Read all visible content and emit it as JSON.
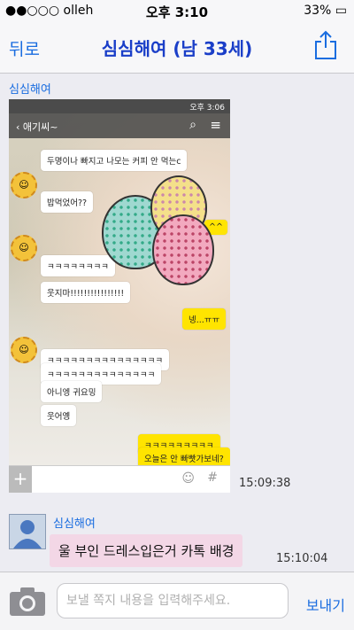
{
  "status_bar": {
    "carrier": "●●○○○ olleh",
    "time": "오후 3:10",
    "battery": "33%"
  },
  "nav": {
    "back": "뒤로",
    "title": "심심해여 (남 33세)"
  },
  "sender_label_top": "심심해여",
  "screenshot": {
    "status_time": "오후 3:06",
    "chat_name": "애기씨~",
    "messages": [
      {
        "text": "두명이나 빠지고 나모는 커피 안 먹는c",
        "mine": false
      },
      {
        "text": "밥먹었어??",
        "mine": false
      },
      {
        "text": "ㅋㅋㅋㅋㅋㅋㅋㅋ",
        "mine": false
      },
      {
        "text": "웃지마!!!!!!!!!!!!!!!!",
        "mine": false
      },
      {
        "text": "넹...ㅠㅠ",
        "mine": true
      },
      {
        "text": "ㅋㅋㅋㅋㅋㅋㅋㅋㅋㅋㅋㅋㅋㅋㅋ",
        "mine": false
      },
      {
        "text": "ㅋㅋㅋㅋㅋㅋㅋㅋㅋㅋㅋㅋㅋㅋ",
        "mine": false
      },
      {
        "text": "아니엥 귀요밍",
        "mine": false
      },
      {
        "text": "웃어옝",
        "mine": false
      },
      {
        "text": "ㅋㅋㅋㅋㅋㅋㅋㅋㅋ",
        "mine": true
      },
      {
        "text": "오늘은 안 빠빳가보네?",
        "mine": true
      }
    ],
    "caret_glyph": "^^",
    "emoji_glyph": "☺",
    "hash_glyph": "#"
  },
  "time_1": "15:09:38",
  "sender_label_2": "심심해여",
  "message_2": "울 부인 드레스입은거 카톡 배경",
  "time_2": "15:10:04",
  "footer": {
    "placeholder": "보낼 쪽지 내용을 입력해주세요.",
    "send": "보내기"
  }
}
